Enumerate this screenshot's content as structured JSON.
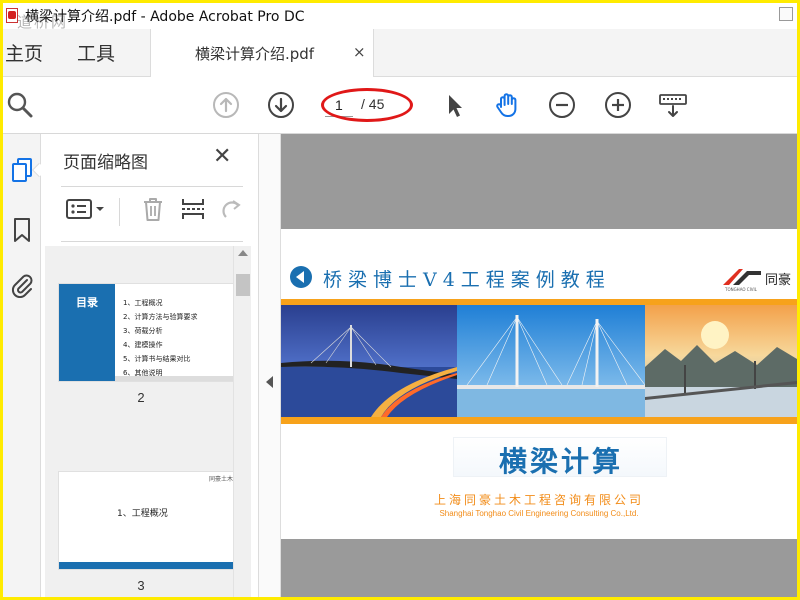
{
  "window": {
    "title": "横梁计算介绍.pdf - Adobe Acrobat Pro DC",
    "watermark": "道桥网"
  },
  "tabs": {
    "home": "主页",
    "tools": "工具",
    "document": "横梁计算介绍.pdf",
    "close": "×"
  },
  "toolbar": {
    "current_page": "1",
    "total_pages": "/ 45",
    "icons": [
      "search-icon",
      "page-up-icon",
      "page-down-icon",
      "select-cursor-icon",
      "hand-tool-icon",
      "zoom-out-icon",
      "zoom-in-icon",
      "keyboard-icon"
    ]
  },
  "rail": {
    "icons": [
      "page-thumbnails-icon",
      "bookmark-icon",
      "attachment-icon"
    ]
  },
  "panel": {
    "title": "页面缩略图",
    "close": "✕",
    "icons": [
      "thumbnail-options-icon",
      "delete-icon",
      "extract-icon",
      "rotate-icon"
    ]
  },
  "thumbnails": [
    {
      "page_number": "2",
      "title": "目录",
      "items": [
        "1、工程概况",
        "2、计算方法与验算要求",
        "3、荷载分析",
        "4、建模操作",
        "5、计算书与结果对比",
        "6、其他说明"
      ]
    },
    {
      "page_number": "3",
      "logo": "同豪土木",
      "text": "1、工程概况"
    }
  ],
  "slide": {
    "heading": "桥梁博士V4工程案例教程",
    "logo_text": "同豪",
    "logo_sub": "TONGHAO CIVIL",
    "title": "横梁计算",
    "company_cn": "上海同豪土木工程咨询有限公司",
    "company_en": "Shanghai  Tonghao Civil Engineering Consulting Co.,Ltd."
  },
  "colors": {
    "accent_blue": "#1a6fb0",
    "orange": "#f7a21b",
    "active_icon": "#1473e6",
    "annotation_red": "#e01818",
    "border_yellow": "#ffeb00"
  }
}
